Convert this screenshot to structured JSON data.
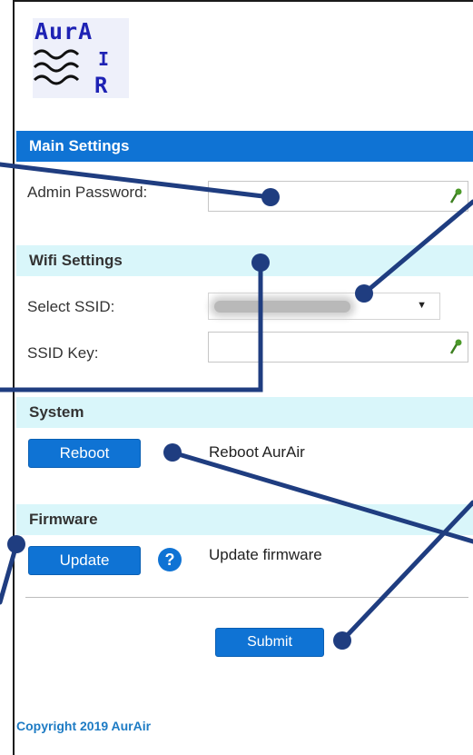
{
  "logo": {
    "top_text": "AurA",
    "right_letters": [
      "I",
      "R"
    ]
  },
  "sections": {
    "main": {
      "title": "Main Settings"
    },
    "wifi": {
      "title": "Wifi Settings"
    },
    "system": {
      "title": "System"
    },
    "firmware": {
      "title": "Firmware"
    }
  },
  "main": {
    "admin_password_label": "Admin Password:"
  },
  "wifi": {
    "select_ssid_label": "Select SSID:",
    "ssid_key_label": "SSID Key:"
  },
  "system": {
    "reboot_label": "Reboot",
    "reboot_desc": "Reboot AurAir"
  },
  "firmware": {
    "update_label": "Update",
    "help_symbol": "?",
    "update_desc": "Update firmware"
  },
  "submit_label": "Submit",
  "copyright": "Copyright 2019 AurAir",
  "colors": {
    "header_blue": "#0f73d4",
    "subheader_bg": "#d9f6fa",
    "callout": "#1f3d80",
    "logo_blue": "#1e22b4"
  },
  "icons": {
    "field_key": "key-icon",
    "ssid_dropdown": "chevron-down-icon",
    "help": "question-icon"
  }
}
